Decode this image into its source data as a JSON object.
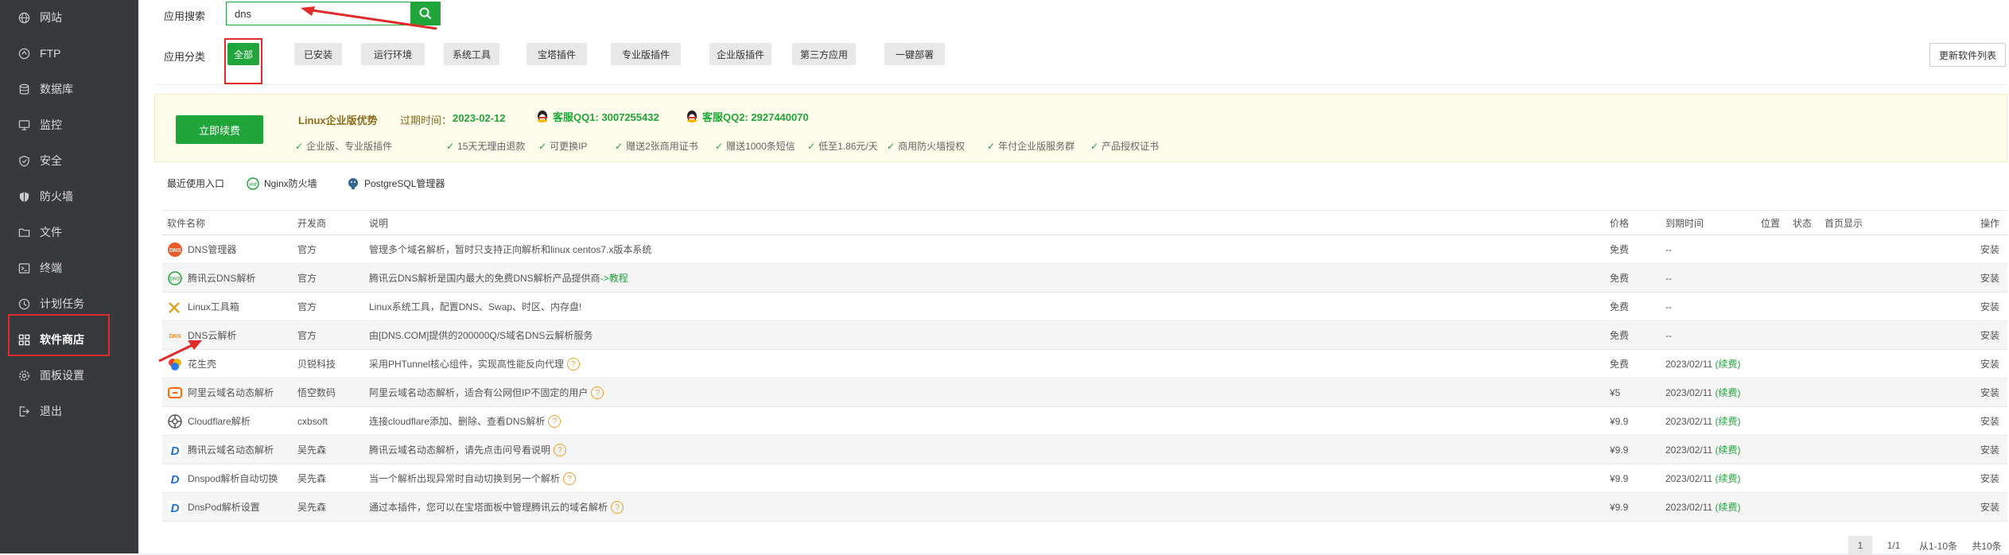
{
  "sidebar": {
    "items": [
      {
        "label": "网站",
        "icon": "globe-icon"
      },
      {
        "label": "FTP",
        "icon": "ftp-icon"
      },
      {
        "label": "数据库",
        "icon": "database-icon"
      },
      {
        "label": "监控",
        "icon": "monitor-icon"
      },
      {
        "label": "安全",
        "icon": "shield-icon"
      },
      {
        "label": "防火墙",
        "icon": "firewall-icon"
      },
      {
        "label": "文件",
        "icon": "folder-icon"
      },
      {
        "label": "终端",
        "icon": "terminal-icon"
      },
      {
        "label": "计划任务",
        "icon": "clock-icon"
      },
      {
        "label": "软件商店",
        "icon": "grid-icon"
      },
      {
        "label": "面板设置",
        "icon": "gear-icon"
      },
      {
        "label": "退出",
        "icon": "logout-icon"
      }
    ]
  },
  "search": {
    "label": "应用搜索",
    "value": "dns"
  },
  "categories": {
    "label": "应用分类",
    "items": [
      "全部",
      "已安装",
      "运行环境",
      "系统工具",
      "宝塔插件",
      "专业版插件",
      "企业版插件",
      "第三方应用",
      "一键部署"
    ]
  },
  "update_button": "更新软件列表",
  "banner": {
    "renew": "立即续费",
    "title": "Linux企业版优势",
    "expire_label": "过期时间：",
    "expire_date": "2023-02-12",
    "qq1": "客服QQ1: 3007255432",
    "qq2": "客服QQ2: 2927440070",
    "features": [
      "企业版、专业版插件",
      "15天无理由退款",
      "可更换IP",
      "赠送2张商用证书",
      "赠送1000条短信",
      "低至1.86元/天",
      "商用防火墙授权",
      "年付企业版服务群",
      "产品授权证书"
    ]
  },
  "recent": {
    "label": "最近使用入口",
    "items": [
      "Nginx防火墙",
      "PostgreSQL管理器"
    ]
  },
  "table": {
    "headers": {
      "name": "软件名称",
      "dev": "开发商",
      "desc": "说明",
      "price": "价格",
      "expire": "到期时间",
      "pos": "位置",
      "status": "状态",
      "home": "首页显示",
      "op": "操作"
    },
    "rows": [
      {
        "name": "DNS管理器",
        "dev": "官方",
        "desc": "管理多个域名解析，暂时只支持正向解析和linux centos7.x版本系统",
        "link": "",
        "price": "免费",
        "expire": "--",
        "renew": "",
        "op": "安装",
        "icon": "dns-icon",
        "paid": false,
        "help": false
      },
      {
        "name": "腾讯云DNS解析",
        "dev": "官方",
        "desc": "腾讯云DNS解析是国内最大的免费DNS解析产品提供商",
        "link": "->教程",
        "price": "免费",
        "expire": "--",
        "renew": "",
        "op": "安装",
        "icon": "tencent-dns-icon",
        "paid": false,
        "help": false
      },
      {
        "name": "Linux工具箱",
        "dev": "官方",
        "desc": "Linux系统工具，配置DNS、Swap、时区、内存盘!",
        "link": "",
        "price": "免费",
        "expire": "--",
        "renew": "",
        "op": "安装",
        "icon": "toolbox-icon",
        "paid": false,
        "help": false
      },
      {
        "name": "DNS云解析",
        "dev": "官方",
        "desc": "由[DNS.COM]提供的200000Q/S域名DNS云解析服务",
        "link": "",
        "price": "免费",
        "expire": "--",
        "renew": "",
        "op": "安装",
        "icon": "dns-cloud-icon",
        "paid": false,
        "help": false
      },
      {
        "name": "花生壳",
        "dev": "贝锐科技",
        "desc": "采用PHTunnel核心组件，实现高性能反向代理",
        "link": "",
        "price": "免费",
        "expire": "2023/02/11",
        "renew": "(续费)",
        "op": "安装",
        "icon": "peanut-icon",
        "paid": false,
        "help": true
      },
      {
        "name": "阿里云域名动态解析",
        "dev": "悟空数码",
        "desc": "阿里云域名动态解析，适合有公网但IP不固定的用户",
        "link": "",
        "price": "¥5",
        "expire": "2023/02/11",
        "renew": "(续费)",
        "op": "安装",
        "icon": "aliyun-icon",
        "paid": true,
        "help": true
      },
      {
        "name": "Cloudflare解析",
        "dev": "cxbsoft",
        "desc": "连接cloudflare添加、删除、查看DNS解析",
        "link": "",
        "price": "¥9.9",
        "expire": "2023/02/11",
        "renew": "(续费)",
        "op": "安装",
        "icon": "cloudflare-icon",
        "paid": true,
        "help": true
      },
      {
        "name": "腾讯云域名动态解析",
        "dev": "吴先森",
        "desc": "腾讯云域名动态解析，请先点击问号看说明",
        "link": "",
        "price": "¥9.9",
        "expire": "2023/02/11",
        "renew": "(续费)",
        "op": "安装",
        "icon": "dnspod-icon",
        "paid": true,
        "help": true
      },
      {
        "name": "Dnspod解析自动切换",
        "dev": "吴先森",
        "desc": "当一个解析出现异常时自动切换到另一个解析",
        "link": "",
        "price": "¥9.9",
        "expire": "2023/02/11",
        "renew": "(续费)",
        "op": "安装",
        "icon": "dnspod-icon",
        "paid": true,
        "help": true
      },
      {
        "name": "DnsPod解析设置",
        "dev": "吴先森",
        "desc": "通过本插件，您可以在宝塔面板中管理腾讯云的域名解析",
        "link": "",
        "price": "¥9.9",
        "expire": "2023/02/11",
        "renew": "(续费)",
        "op": "安装",
        "icon": "dnspod-icon",
        "paid": true,
        "help": true
      }
    ]
  },
  "pager": {
    "current": "1",
    "pages": "1/1",
    "range": "从1-10条",
    "total": "共10条"
  }
}
